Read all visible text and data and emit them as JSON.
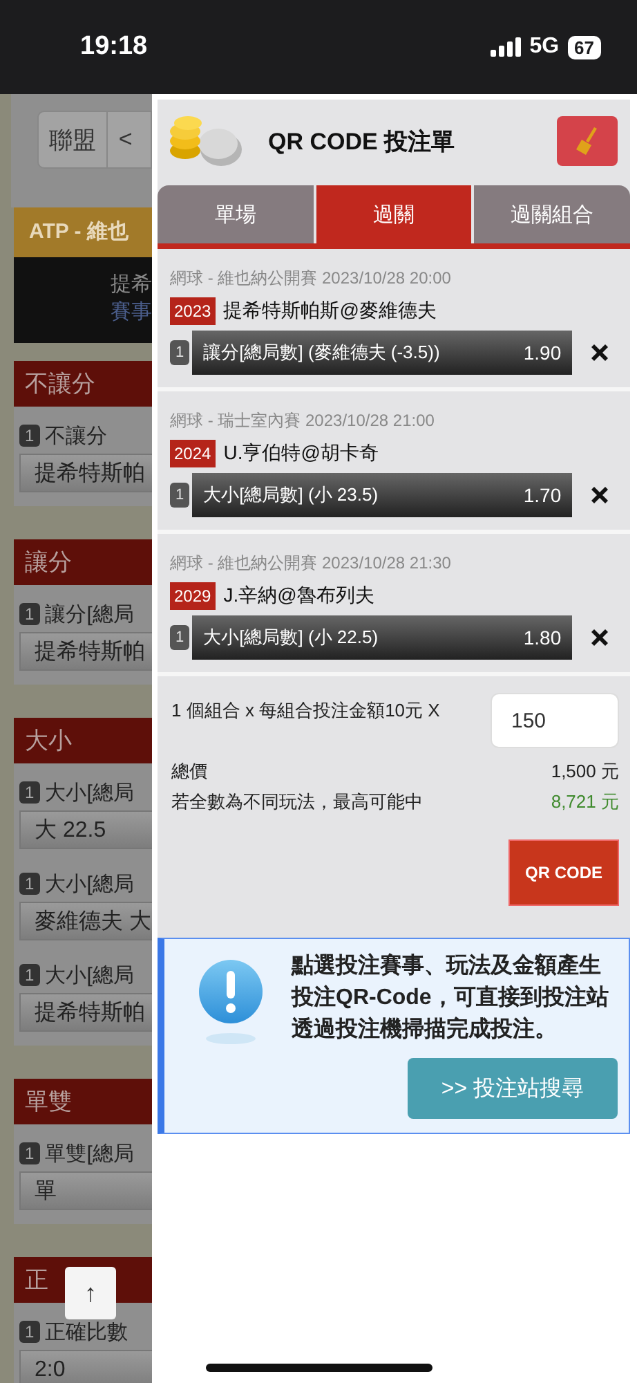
{
  "status_bar": {
    "time": "19:18",
    "network": "5G",
    "battery": "67"
  },
  "background_page": {
    "league_button": "聯盟",
    "prev_button": "<",
    "match_header": "ATP - 維也",
    "match_lines": [
      "提希",
      "賽事"
    ],
    "sections": [
      {
        "title": "不讓分",
        "bets": [
          {
            "number": "1",
            "label": "不讓分",
            "choice": "提希特斯帕"
          }
        ]
      },
      {
        "title": "讓分",
        "bets": [
          {
            "number": "1",
            "label": "讓分[總局",
            "choice": "提希特斯帕"
          }
        ]
      },
      {
        "title": "大小",
        "bets": [
          {
            "number": "1",
            "label": "大小[總局",
            "choice": "大 22.5"
          },
          {
            "number": "1",
            "label": "大小[總局",
            "choice": "麥維德夫 大"
          },
          {
            "number": "1",
            "label": "大小[總局",
            "choice": "提希特斯帕"
          }
        ]
      },
      {
        "title": "單雙",
        "bets": [
          {
            "number": "1",
            "label": "單雙[總局",
            "choice": "單"
          }
        ]
      },
      {
        "title": "正",
        "bets": [
          {
            "number": "1",
            "label": "正確比數",
            "choice": "2:0"
          }
        ]
      }
    ],
    "scroll_top_button": "↑"
  },
  "bet_slip": {
    "title": "QR CODE 投注單",
    "tabs": [
      {
        "label": "單場",
        "selected": false
      },
      {
        "label": "過關",
        "selected": true
      },
      {
        "label": "過關組合",
        "selected": false
      }
    ],
    "bets": [
      {
        "meta": "網球 - 維也納公開賽 2023/10/28 20:00",
        "code": "2023",
        "event": "提希特斯帕斯@麥維德夫",
        "number": "1",
        "selection": "讓分[總局數] (麥維德夫 (-3.5))",
        "odds": "1.90"
      },
      {
        "meta": "網球 - 瑞士室內賽 2023/10/28 21:00",
        "code": "2024",
        "event": "U.亨伯特@胡卡奇",
        "number": "1",
        "selection": "大小[總局數] (小 23.5)",
        "odds": "1.70"
      },
      {
        "meta": "網球 - 維也納公開賽 2023/10/28 21:30",
        "code": "2029",
        "event": "J.辛納@魯布列夫",
        "number": "1",
        "selection": "大小[總局數] (小 22.5)",
        "odds": "1.80"
      }
    ],
    "summary": {
      "stake_label": "1 個組合 x 每組合投注金額10元 X",
      "stake_value": "150",
      "total_label": "總價",
      "total_value": "1,500 元",
      "max_label": "若全數為不同玩法，最高可能中",
      "max_value": "8,721 元"
    },
    "qr_button": "QR CODE",
    "info": {
      "message": "點選投注賽事、玩法及金額產生投注QR-Code，可直接到投注站透過投注機掃描完成投注。",
      "button": ">> 投注站搜尋"
    }
  }
}
